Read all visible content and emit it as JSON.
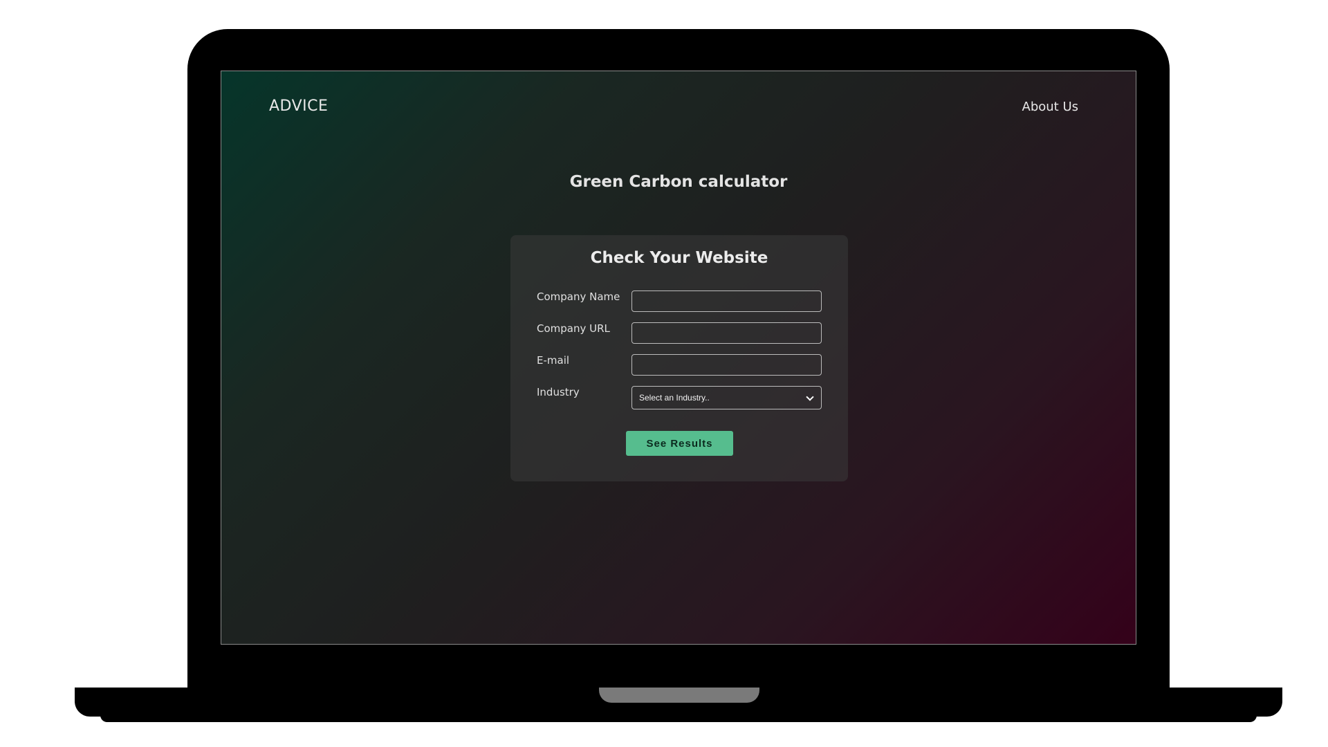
{
  "header": {
    "brand": "ADVICE",
    "nav_about": "About Us"
  },
  "main": {
    "title": "Green Carbon calculator"
  },
  "form": {
    "title": "Check Your Website",
    "fields": [
      {
        "label": "Company Name",
        "value": ""
      },
      {
        "label": "Company URL",
        "value": ""
      },
      {
        "label": "E-mail",
        "value": ""
      }
    ],
    "industry": {
      "label": "Industry",
      "selected": "Select an Industry.."
    },
    "submit_label": "See Results"
  },
  "colors": {
    "accent": "#56bd8e",
    "gradient_start": "#06352a",
    "gradient_end": "#34011a"
  }
}
